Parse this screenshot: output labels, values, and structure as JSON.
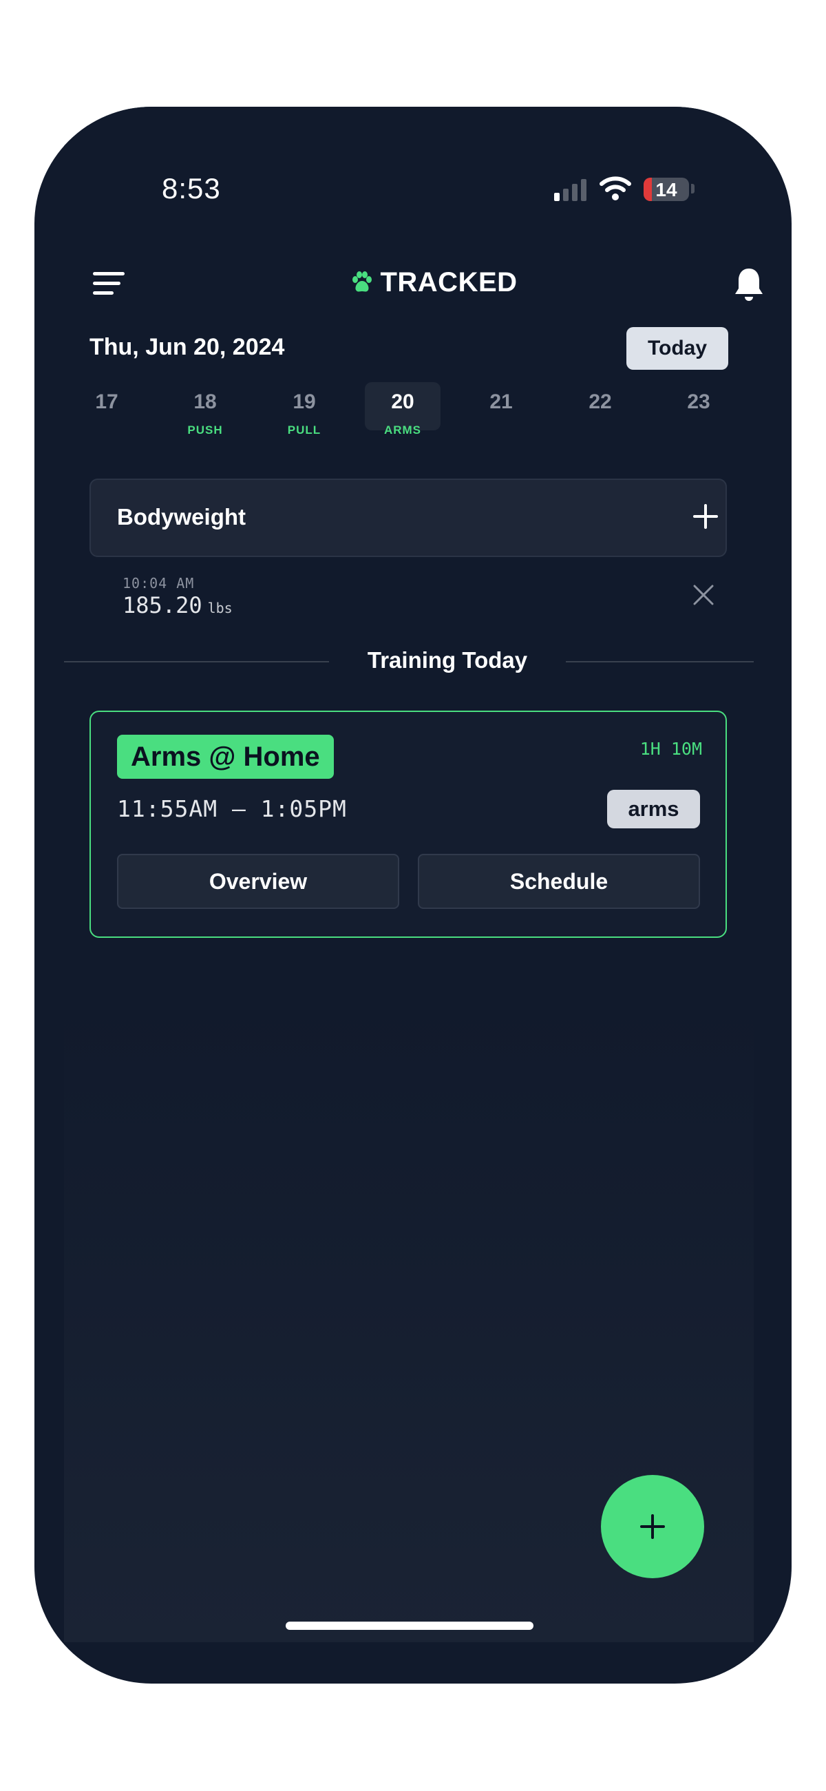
{
  "status_bar": {
    "time": "8:53",
    "battery": "14",
    "icons": [
      "signal-icon",
      "wifi-icon",
      "battery-icon"
    ]
  },
  "header": {
    "brand": "TRACKED",
    "icons": [
      "menu-icon",
      "paw-icon",
      "bell-icon"
    ]
  },
  "date_bar": {
    "date": "Thu, Jun 20, 2024",
    "today_label": "Today"
  },
  "week": {
    "days": [
      {
        "num": "17",
        "label": ""
      },
      {
        "num": "18",
        "label": "PUSH"
      },
      {
        "num": "19",
        "label": "PULL"
      },
      {
        "num": "20",
        "label": "ARMS",
        "selected": true
      },
      {
        "num": "21",
        "label": ""
      },
      {
        "num": "22",
        "label": ""
      },
      {
        "num": "23",
        "label": ""
      }
    ]
  },
  "bodyweight": {
    "title": "Bodyweight",
    "entry_time": "10:04 AM",
    "entry_value": "185.20",
    "entry_unit": "lbs"
  },
  "training": {
    "section_title": "Training Today",
    "workout": {
      "title": "Arms @ Home",
      "duration": "1H 10M",
      "time_range": "11:55AM – 1:05PM",
      "tag": "arms",
      "overview_label": "Overview",
      "schedule_label": "Schedule"
    }
  },
  "colors": {
    "background": "#111a2c",
    "accent": "#4ade80",
    "card": "#1e2637",
    "battery_low": "#e03a3a"
  }
}
